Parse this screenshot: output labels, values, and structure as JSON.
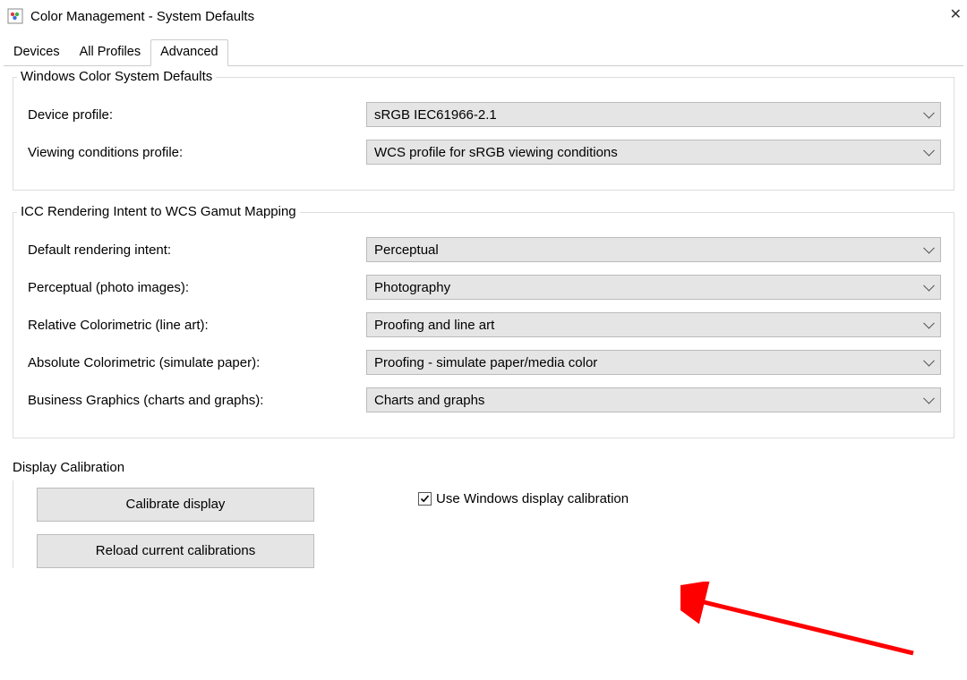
{
  "window": {
    "title": "Color Management - System Defaults"
  },
  "tabs": {
    "devices": "Devices",
    "all_profiles": "All Profiles",
    "advanced": "Advanced"
  },
  "wcs_defaults": {
    "legend": "Windows Color System Defaults",
    "device_profile_label": "Device profile:",
    "device_profile_value": "sRGB IEC61966-2.1",
    "viewing_cond_label": "Viewing conditions profile:",
    "viewing_cond_value": "WCS profile for sRGB viewing conditions"
  },
  "icc_mapping": {
    "legend": "ICC Rendering Intent to WCS Gamut Mapping",
    "default_label": "Default rendering intent:",
    "default_value": "Perceptual",
    "perceptual_label": "Perceptual (photo images):",
    "perceptual_value": "Photography",
    "relative_label": "Relative Colorimetric (line art):",
    "relative_value": "Proofing and line art",
    "absolute_label": "Absolute Colorimetric (simulate paper):",
    "absolute_value": "Proofing - simulate paper/media color",
    "business_label": "Business Graphics (charts and graphs):",
    "business_value": "Charts and graphs"
  },
  "calibration": {
    "legend": "Display Calibration",
    "calibrate_btn": "Calibrate display",
    "reload_btn": "Reload current calibrations",
    "use_windows_label": "Use Windows display calibration",
    "use_windows_checked": true
  }
}
